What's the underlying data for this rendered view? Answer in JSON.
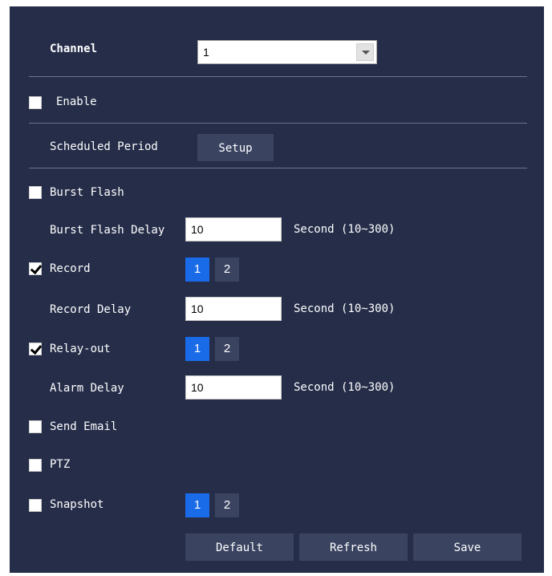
{
  "channel": {
    "label": "Channel",
    "value": "1"
  },
  "enable": {
    "label": "Enable",
    "checked": false
  },
  "scheduled_period": {
    "label": "Scheduled Period",
    "button": "Setup"
  },
  "burst_flash": {
    "label": "Burst Flash",
    "checked": false
  },
  "burst_flash_delay": {
    "label": "Burst Flash Delay",
    "value": "10",
    "unit": "Second (10~300)"
  },
  "record": {
    "label": "Record",
    "checked": true,
    "options": [
      "1",
      "2"
    ],
    "selected": "1"
  },
  "record_delay": {
    "label": "Record Delay",
    "value": "10",
    "unit": "Second (10~300)"
  },
  "relay_out": {
    "label": "Relay-out",
    "checked": true,
    "options": [
      "1",
      "2"
    ],
    "selected": "1"
  },
  "alarm_delay": {
    "label": "Alarm Delay",
    "value": "10",
    "unit": "Second (10~300)"
  },
  "send_email": {
    "label": "Send Email",
    "checked": false
  },
  "ptz": {
    "label": "PTZ",
    "checked": false
  },
  "snapshot": {
    "label": "Snapshot",
    "checked": false,
    "options": [
      "1",
      "2"
    ],
    "selected": "1"
  },
  "footer": {
    "default": "Default",
    "refresh": "Refresh",
    "save": "Save"
  },
  "colors": {
    "panel_bg": "#252d49",
    "accent": "#1a6be8",
    "button_bg": "#3a4461"
  },
  "icons": {
    "dropdown": "chevron-down-icon",
    "check": "checkmark-icon"
  }
}
